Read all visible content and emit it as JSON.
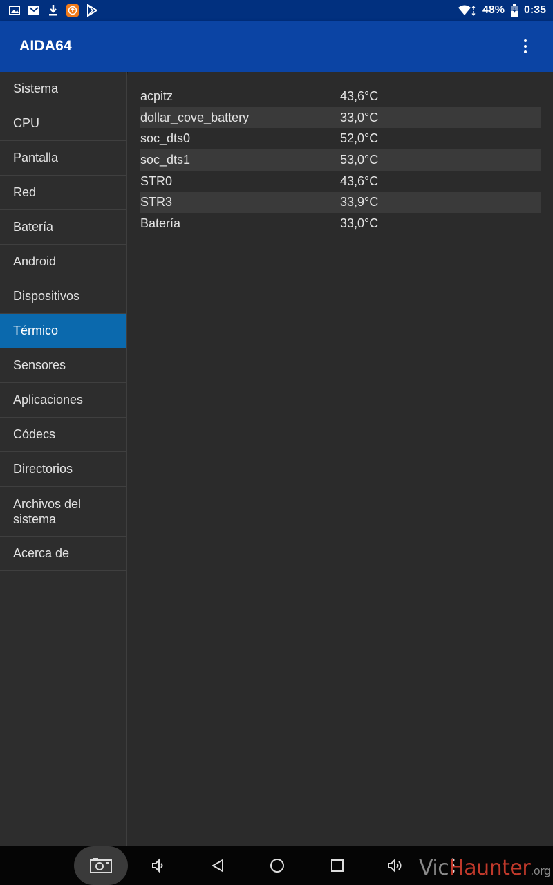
{
  "status_bar": {
    "icons_left": [
      "gallery-icon",
      "email-icon",
      "download-icon",
      "upload-app-icon",
      "play-store-icon"
    ],
    "wifi": "wifi-icon",
    "battery_percent": "48%",
    "time": "0:35"
  },
  "app_bar": {
    "title": "AIDA64",
    "menu_icon": "overflow-menu-icon"
  },
  "sidebar": {
    "items": [
      {
        "label": "Sistema",
        "active": false
      },
      {
        "label": "CPU",
        "active": false
      },
      {
        "label": "Pantalla",
        "active": false
      },
      {
        "label": "Red",
        "active": false
      },
      {
        "label": "Batería",
        "active": false
      },
      {
        "label": "Android",
        "active": false
      },
      {
        "label": "Dispositivos",
        "active": false
      },
      {
        "label": "Térmico",
        "active": true
      },
      {
        "label": "Sensores",
        "active": false
      },
      {
        "label": "Aplicaciones",
        "active": false
      },
      {
        "label": "Códecs",
        "active": false
      },
      {
        "label": "Directorios",
        "active": false
      },
      {
        "label": "Archivos del sistema",
        "active": false
      },
      {
        "label": "Acerca de",
        "active": false
      }
    ]
  },
  "thermal": {
    "rows": [
      {
        "name": "acpitz",
        "value": "43,6°C"
      },
      {
        "name": "dollar_cove_battery",
        "value": "33,0°C"
      },
      {
        "name": "soc_dts0",
        "value": "52,0°C"
      },
      {
        "name": "soc_dts1",
        "value": "53,0°C"
      },
      {
        "name": "STR0",
        "value": "43,6°C"
      },
      {
        "name": "STR3",
        "value": "33,9°C"
      },
      {
        "name": "Batería",
        "value": "33,0°C"
      }
    ]
  },
  "nav_bar": {
    "buttons": [
      "screenshot-icon",
      "volume-down-icon",
      "back-icon",
      "home-icon",
      "recents-icon",
      "volume-up-icon",
      "overflow-menu-icon"
    ]
  },
  "watermark": {
    "part1": "Vic",
    "part2": "Haunter",
    "part3": ".org"
  },
  "colors": {
    "status_bar": "#01307f",
    "app_bar": "#0b44a4",
    "active_item": "#0b69ad",
    "background": "#2b2b2b",
    "row_alt": "#3a3a3a"
  }
}
